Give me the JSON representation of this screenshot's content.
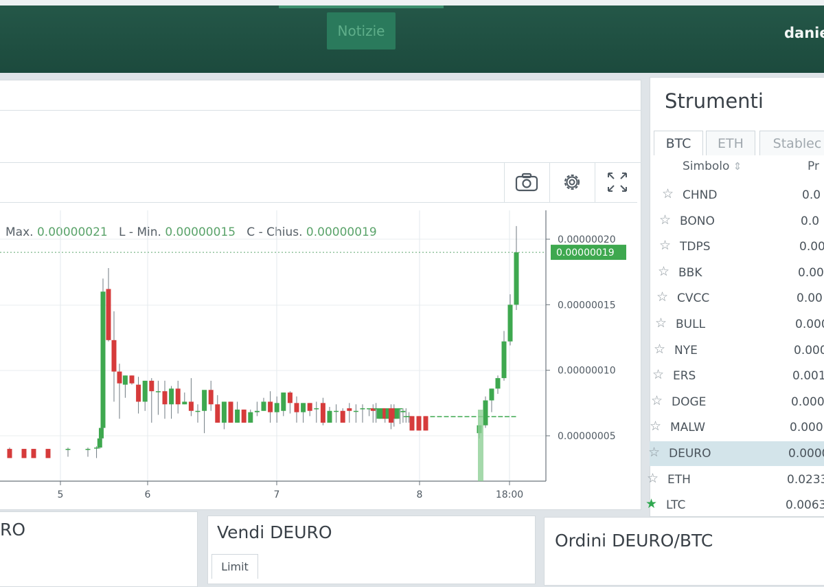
{
  "header": {
    "news_tab": "Notizie",
    "user": "danie"
  },
  "chart": {
    "ohlc": {
      "max_label": "Max.",
      "max_value": "0.00000021",
      "min_label": "L - Min.",
      "min_value": "0.00000015",
      "close_label": "C - Chius.",
      "close_value": "0.00000019"
    },
    "toolbar_icons": [
      "camera-icon",
      "gear-icon",
      "fullscreen-icon"
    ]
  },
  "chart_data": {
    "type": "candlestick",
    "x_tick_labels": [
      "5",
      "6",
      "7",
      "8",
      "18:00"
    ],
    "y_tick_labels": [
      "0.00000020",
      "0.00000015",
      "0.00000010",
      "0.00000005"
    ],
    "current_price_label": "0.00000019",
    "ylim": [
      3.2e-08,
      2.21e-07
    ],
    "up_color": "#3ea84f",
    "down_color": "#d63b3b",
    "candles": [
      {
        "x": 0.2,
        "o": 4.0,
        "h": 4.1,
        "l": 3.3,
        "c": 3.3
      },
      {
        "x": 0.5,
        "o": 4.0,
        "h": 4.0,
        "l": 3.3,
        "c": 3.3
      },
      {
        "x": 0.7,
        "o": 4.0,
        "h": 4.0,
        "l": 3.3,
        "c": 3.3
      },
      {
        "x": 1.0,
        "o": 4.0,
        "h": 4.0,
        "l": 3.3,
        "c": 3.3
      },
      {
        "x": 1.5,
        "o": 4.0,
        "h": 4.1,
        "l": 3.4,
        "c": 4.0
      },
      {
        "x": 2.0,
        "o": 4.0,
        "h": 4.1,
        "l": 3.4,
        "c": 4.0
      },
      {
        "x": 2.4,
        "o": 4.1,
        "h": 4.2,
        "l": 3.3,
        "c": 4.1
      },
      {
        "x": 2.55,
        "o": 4.1,
        "h": 5.0,
        "l": 4.0,
        "c": 4.8
      },
      {
        "x": 2.62,
        "o": 4.8,
        "h": 5.8,
        "l": 4.7,
        "c": 5.6
      },
      {
        "x": 2.7,
        "o": 5.6,
        "h": 17.0,
        "l": 5.5,
        "c": 16.0
      },
      {
        "x": 2.78,
        "o": 16.2,
        "h": 17.8,
        "l": 12.2,
        "c": 12.3
      },
      {
        "x": 2.86,
        "o": 12.3,
        "h": 14.5,
        "l": 7.6,
        "c": 9.9
      },
      {
        "x": 2.94,
        "o": 9.9,
        "h": 10.5,
        "l": 6.3,
        "c": 9.0
      },
      {
        "x": 3.02,
        "o": 8.9,
        "h": 9.6,
        "l": 7.9,
        "c": 9.6
      },
      {
        "x": 3.1,
        "o": 9.6,
        "h": 9.6,
        "l": 8.9,
        "c": 9.0
      },
      {
        "x": 3.18,
        "o": 8.9,
        "h": 9.5,
        "l": 6.7,
        "c": 7.6
      },
      {
        "x": 3.26,
        "o": 7.6,
        "h": 9.2,
        "l": 6.9,
        "c": 9.2
      },
      {
        "x": 3.34,
        "o": 9.2,
        "h": 9.4,
        "l": 6.0,
        "c": 8.4
      },
      {
        "x": 3.42,
        "o": 8.4,
        "h": 9.2,
        "l": 6.6,
        "c": 8.4
      },
      {
        "x": 3.5,
        "o": 8.4,
        "h": 9.2,
        "l": 6.3,
        "c": 7.4
      },
      {
        "x": 3.58,
        "o": 7.4,
        "h": 8.8,
        "l": 6.3,
        "c": 8.6
      },
      {
        "x": 3.66,
        "o": 8.6,
        "h": 9.2,
        "l": 6.7,
        "c": 7.4
      },
      {
        "x": 3.74,
        "o": 7.4,
        "h": 8.3,
        "l": 7.4,
        "c": 7.6
      },
      {
        "x": 3.82,
        "o": 7.6,
        "h": 9.4,
        "l": 6.5,
        "c": 6.9
      },
      {
        "x": 3.9,
        "o": 6.9,
        "h": 7.4,
        "l": 6.0,
        "c": 6.9
      },
      {
        "x": 3.98,
        "o": 6.9,
        "h": 8.0,
        "l": 5.2,
        "c": 8.5
      },
      {
        "x": 4.06,
        "o": 8.5,
        "h": 9.2,
        "l": 6.9,
        "c": 7.4
      },
      {
        "x": 4.14,
        "o": 7.4,
        "h": 8.1,
        "l": 6.0,
        "c": 6.0
      },
      {
        "x": 4.22,
        "o": 6.0,
        "h": 7.6,
        "l": 5.5,
        "c": 7.6
      },
      {
        "x": 4.3,
        "o": 7.6,
        "h": 7.6,
        "l": 6.0,
        "c": 6.0
      },
      {
        "x": 4.38,
        "o": 6.0,
        "h": 7.6,
        "l": 6.0,
        "c": 7.0
      },
      {
        "x": 4.46,
        "o": 7.0,
        "h": 7.0,
        "l": 6.0,
        "c": 6.0
      },
      {
        "x": 4.54,
        "o": 6.0,
        "h": 7.0,
        "l": 6.0,
        "c": 6.8
      },
      {
        "x": 4.62,
        "o": 6.8,
        "h": 7.6,
        "l": 6.5,
        "c": 6.9
      },
      {
        "x": 4.7,
        "o": 6.9,
        "h": 7.9,
        "l": 6.9,
        "c": 7.6
      },
      {
        "x": 4.78,
        "o": 7.6,
        "h": 8.4,
        "l": 6.0,
        "c": 6.8
      },
      {
        "x": 4.86,
        "o": 6.8,
        "h": 8.0,
        "l": 6.0,
        "c": 7.5
      },
      {
        "x": 4.94,
        "o": 6.9,
        "h": 8.3,
        "l": 6.5,
        "c": 8.3
      },
      {
        "x": 5.02,
        "o": 8.3,
        "h": 8.4,
        "l": 6.7,
        "c": 7.5
      },
      {
        "x": 5.1,
        "o": 7.5,
        "h": 8.0,
        "l": 6.0,
        "c": 6.8
      },
      {
        "x": 5.18,
        "o": 6.8,
        "h": 7.5,
        "l": 6.0,
        "c": 7.5
      },
      {
        "x": 5.26,
        "o": 7.5,
        "h": 7.5,
        "l": 6.5,
        "c": 6.9
      },
      {
        "x": 5.34,
        "o": 7.1,
        "h": 7.6,
        "l": 6.0,
        "c": 7.1
      },
      {
        "x": 5.42,
        "o": 7.5,
        "h": 7.9,
        "l": 5.8,
        "c": 6.0
      },
      {
        "x": 5.5,
        "o": 6.0,
        "h": 7.2,
        "l": 6.0,
        "c": 6.9
      },
      {
        "x": 5.58,
        "o": 6.9,
        "h": 7.4,
        "l": 6.0,
        "c": 6.9
      },
      {
        "x": 5.66,
        "o": 6.9,
        "h": 7.1,
        "l": 6.5,
        "c": 6.0
      },
      {
        "x": 5.74,
        "o": 7.1,
        "h": 7.5,
        "l": 6.0,
        "c": 6.9
      },
      {
        "x": 5.82,
        "o": 6.9,
        "h": 7.4,
        "l": 6.0,
        "c": 6.9
      },
      {
        "x": 5.9,
        "o": 7.1,
        "h": 7.4,
        "l": 6.0,
        "c": 7.1
      },
      {
        "x": 5.98,
        "o": 7.1,
        "h": 7.1,
        "l": 6.5,
        "c": 7.1
      },
      {
        "x": 6.06,
        "o": 7.1,
        "h": 7.4,
        "l": 6.0,
        "c": 6.9
      },
      {
        "x": 6.14,
        "o": 7.1,
        "h": 7.5,
        "l": 6.0,
        "c": 7.1
      },
      {
        "x": 6.22,
        "o": 6.3,
        "h": 7.1,
        "l": 6.3,
        "c": 7.1
      },
      {
        "x": 6.3,
        "o": 6.3,
        "h": 7.1,
        "l": 6.3,
        "c": 7.1
      },
      {
        "x": 6.38,
        "o": 7.1,
        "h": 7.1,
        "l": 6.0,
        "c": 6.3
      },
      {
        "x": 6.46,
        "o": 6.3,
        "h": 7.1,
        "l": 6.3,
        "c": 7.1
      },
      {
        "x": 6.54,
        "o": 7.1,
        "h": 7.4,
        "l": 5.5,
        "c": 6.0
      },
      {
        "x": 6.62,
        "o": 7.1,
        "h": 7.4,
        "l": 5.7,
        "c": 6.3
      },
      {
        "x": 6.7,
        "o": 6.3,
        "h": 7.1,
        "l": 6.3,
        "c": 7.1
      },
      {
        "x": 6.78,
        "o": 7.1,
        "h": 7.1,
        "l": 5.9,
        "c": 7.1
      },
      {
        "x": 6.86,
        "o": 6.8,
        "h": 7.1,
        "l": 6.0,
        "c": 6.9
      },
      {
        "x": 6.94,
        "o": 6.5,
        "h": 7.1,
        "l": 6.0,
        "c": 6.5
      },
      {
        "x": 7.02,
        "o": 6.5,
        "h": 6.8,
        "l": 6.0,
        "c": 6.5
      },
      {
        "x": 7.1,
        "o": 6.5,
        "h": 6.5,
        "l": 5.4,
        "c": 5.4
      },
      {
        "x": 7.18,
        "o": 6.5,
        "h": 6.5,
        "l": 5.4,
        "c": 5.4
      },
      {
        "x": 7.26,
        "o": 6.5,
        "h": 6.5,
        "l": 5.4,
        "c": 5.4
      },
      {
        "x": 7.34,
        "o": 6.5,
        "h": 6.5,
        "l": 6.5,
        "c": 6.5
      },
      {
        "x": 7.42,
        "o": 6.5,
        "h": 6.5,
        "l": 6.5,
        "c": 6.5
      },
      {
        "x": 7.5,
        "o": 6.5,
        "h": 6.5,
        "l": 6.5,
        "c": 6.5
      },
      {
        "x": 7.58,
        "o": 6.5,
        "h": 6.5,
        "l": 6.5,
        "c": 6.5
      },
      {
        "x": 7.66,
        "o": 6.5,
        "h": 6.5,
        "l": 6.5,
        "c": 6.5
      },
      {
        "x": 7.74,
        "o": 6.5,
        "h": 6.5,
        "l": 6.5,
        "c": 6.5
      },
      {
        "x": 7.82,
        "o": 6.5,
        "h": 6.5,
        "l": 6.5,
        "c": 6.5
      },
      {
        "x": 7.9,
        "o": 6.5,
        "h": 6.5,
        "l": 6.5,
        "c": 6.5
      },
      {
        "x": 7.98,
        "o": 6.5,
        "h": 6.5,
        "l": 6.5,
        "c": 6.5
      },
      {
        "x": 8.06,
        "o": 6.5,
        "h": 6.5,
        "l": 6.5,
        "c": 6.5
      },
      {
        "x": 8.14,
        "o": 6.5,
        "h": 6.5,
        "l": 6.5,
        "c": 6.5
      },
      {
        "x": 8.22,
        "o": 6.5,
        "h": 6.5,
        "l": 6.5,
        "c": 6.5
      },
      {
        "x": 8.3,
        "o": 6.5,
        "h": 6.5,
        "l": 6.5,
        "c": 6.5
      }
    ]
  },
  "tools": {
    "title": "Strumenti",
    "tabs": [
      "BTC",
      "ETH",
      "Stablec"
    ],
    "col_symbol": "Simbolo",
    "col_price": "Pr",
    "rows": [
      {
        "symbol": "CHND",
        "price": "0.0"
      },
      {
        "symbol": "BONO",
        "price": "0.0"
      },
      {
        "symbol": "TDPS",
        "price": "0.00"
      },
      {
        "symbol": "BBK",
        "price": "0.00"
      },
      {
        "symbol": "CVCC",
        "price": "0.00"
      },
      {
        "symbol": "BULL",
        "price": "0.000"
      },
      {
        "symbol": "NYE",
        "price": "0.000"
      },
      {
        "symbol": "ERS",
        "price": "0.001"
      },
      {
        "symbol": "DOGE",
        "price": "0.000"
      },
      {
        "symbol": "MALW",
        "price": "0.000"
      },
      {
        "symbol": "DEURO",
        "price": "0.0000"
      },
      {
        "symbol": "ETH",
        "price": "0.0233"
      },
      {
        "symbol": "LTC",
        "price": "0.0063"
      }
    ]
  },
  "bottom": {
    "left_title": "RO",
    "sell_title": "Vendi DEURO",
    "limit_tab": "Limit",
    "orders_title": "Ordini DEURO/BTC"
  }
}
